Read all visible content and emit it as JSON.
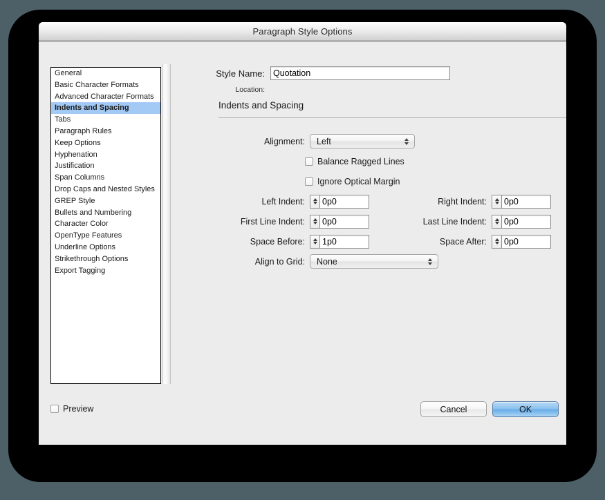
{
  "window": {
    "title": "Paragraph Style Options"
  },
  "sidebar": {
    "items": [
      {
        "label": "General",
        "selected": false
      },
      {
        "label": "Basic Character Formats",
        "selected": false
      },
      {
        "label": "Advanced Character Formats",
        "selected": false
      },
      {
        "label": "Indents and Spacing",
        "selected": true
      },
      {
        "label": "Tabs",
        "selected": false
      },
      {
        "label": "Paragraph Rules",
        "selected": false
      },
      {
        "label": "Keep Options",
        "selected": false
      },
      {
        "label": "Hyphenation",
        "selected": false
      },
      {
        "label": "Justification",
        "selected": false
      },
      {
        "label": "Span Columns",
        "selected": false
      },
      {
        "label": "Drop Caps and Nested Styles",
        "selected": false
      },
      {
        "label": "GREP Style",
        "selected": false
      },
      {
        "label": "Bullets and Numbering",
        "selected": false
      },
      {
        "label": "Character Color",
        "selected": false
      },
      {
        "label": "OpenType Features",
        "selected": false
      },
      {
        "label": "Underline Options",
        "selected": false
      },
      {
        "label": "Strikethrough Options",
        "selected": false
      },
      {
        "label": "Export Tagging",
        "selected": false
      }
    ]
  },
  "header": {
    "style_name_label": "Style Name:",
    "style_name_value": "Quotation",
    "location_label": "Location:",
    "location_value": ""
  },
  "section": {
    "title": "Indents and Spacing"
  },
  "fields": {
    "alignment": {
      "label": "Alignment:",
      "value": "Left"
    },
    "balance_ragged_lines": {
      "label": "Balance Ragged Lines",
      "checked": false
    },
    "ignore_optical_margin": {
      "label": "Ignore Optical Margin",
      "checked": false
    },
    "left_indent": {
      "label": "Left Indent:",
      "value": "0p0"
    },
    "right_indent": {
      "label": "Right Indent:",
      "value": "0p0"
    },
    "first_line_indent": {
      "label": "First Line Indent:",
      "value": "0p0"
    },
    "last_line_indent": {
      "label": "Last Line Indent:",
      "value": "0p0"
    },
    "space_before": {
      "label": "Space Before:",
      "value": "1p0"
    },
    "space_after": {
      "label": "Space After:",
      "value": "0p0"
    },
    "align_to_grid": {
      "label": "Align to Grid:",
      "value": "None"
    }
  },
  "footer": {
    "preview_label": "Preview",
    "preview_checked": false,
    "cancel_label": "Cancel",
    "ok_label": "OK"
  },
  "colors": {
    "selection_blue": "#a3caf5",
    "ok_button_blue": "#8fc3ef",
    "desktop_background": "#4d6068",
    "dialog_background": "#ececec"
  }
}
